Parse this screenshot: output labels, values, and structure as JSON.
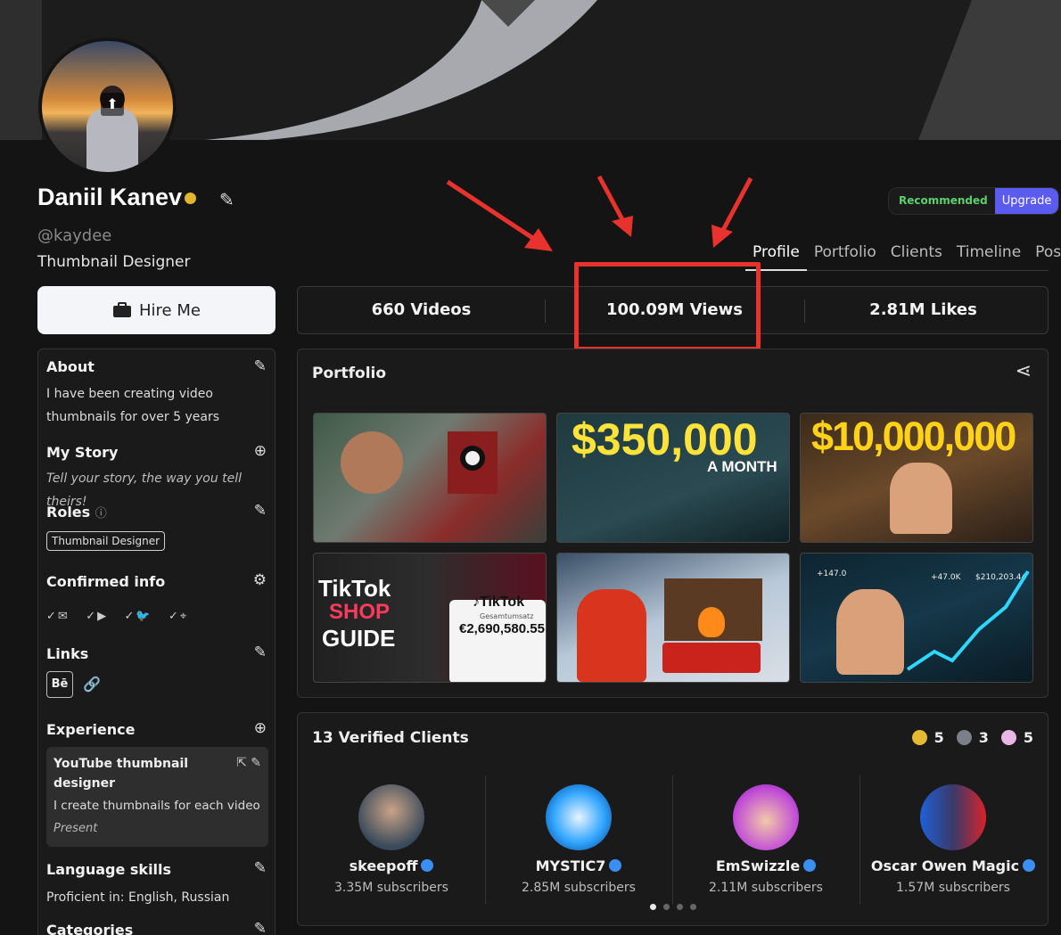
{
  "profile": {
    "name": "Daniil Kanev",
    "handle": "@kaydee",
    "title": "Thumbnail Designer",
    "hire_label": "Hire Me"
  },
  "plan": {
    "recommended_label": "Recommended",
    "upgrade_label": "Upgrade"
  },
  "tabs": [
    "Profile",
    "Portfolio",
    "Clients",
    "Timeline",
    "Posts"
  ],
  "stats": {
    "videos": "660 Videos",
    "views": "100.09M Views",
    "likes": "2.81M Likes"
  },
  "sidebar": {
    "about_heading": "About",
    "about_text": "I have been creating video thumbnails for over 5 years",
    "story_heading": "My Story",
    "story_text": "Tell your story, the way you tell theirs!",
    "roles_heading": "Roles",
    "role_tag": "Thumbnail Designer",
    "confirmed_heading": "Confirmed info",
    "links_heading": "Links",
    "behance_label": "Bē",
    "experience_heading": "Experience",
    "experience_title": "YouTube thumbnail designer",
    "experience_desc": "I create thumbnails for each video",
    "experience_date": "Present",
    "language_heading": "Language skills",
    "language_text": "Proficient in: English, Russian",
    "categories_heading": "Categories"
  },
  "portfolio": {
    "title": "Portfolio",
    "thumb_texts": {
      "t2_big": "$350,000",
      "t2_small": "A MONTH",
      "t3_big": "$10,000,000",
      "t4_line1": "TikTok",
      "t4_line2": "SHOP",
      "t4_line3": "GUIDE",
      "t4_brand": "♪TikTok",
      "t4_sub": "Gesamtumsatz",
      "t4_amount": "€2,690,580.55",
      "t6_v1": "+147.0",
      "t6_v2": "+47.0K",
      "t6_v3": "$210,203.44"
    }
  },
  "clients": {
    "title": "13 Verified Clients",
    "badges": [
      {
        "count": "5",
        "color": "#e7b933"
      },
      {
        "count": "3",
        "color": "#7a7f88"
      },
      {
        "count": "5",
        "color": "#e9b7e6"
      }
    ],
    "items": [
      {
        "name": "skeepoff",
        "subs": "3.35M subscribers"
      },
      {
        "name": "MYSTIC7",
        "subs": "2.85M subscribers"
      },
      {
        "name": "EmSwizzle",
        "subs": "2.11M subscribers"
      },
      {
        "name": "Oscar Owen Magic",
        "subs": "1.57M subscribers"
      }
    ]
  },
  "colors": {
    "accent": "#5b5bf0",
    "highlight": "#e8322d",
    "recommended": "#5cd06a",
    "verified": "#3b8ff2"
  }
}
